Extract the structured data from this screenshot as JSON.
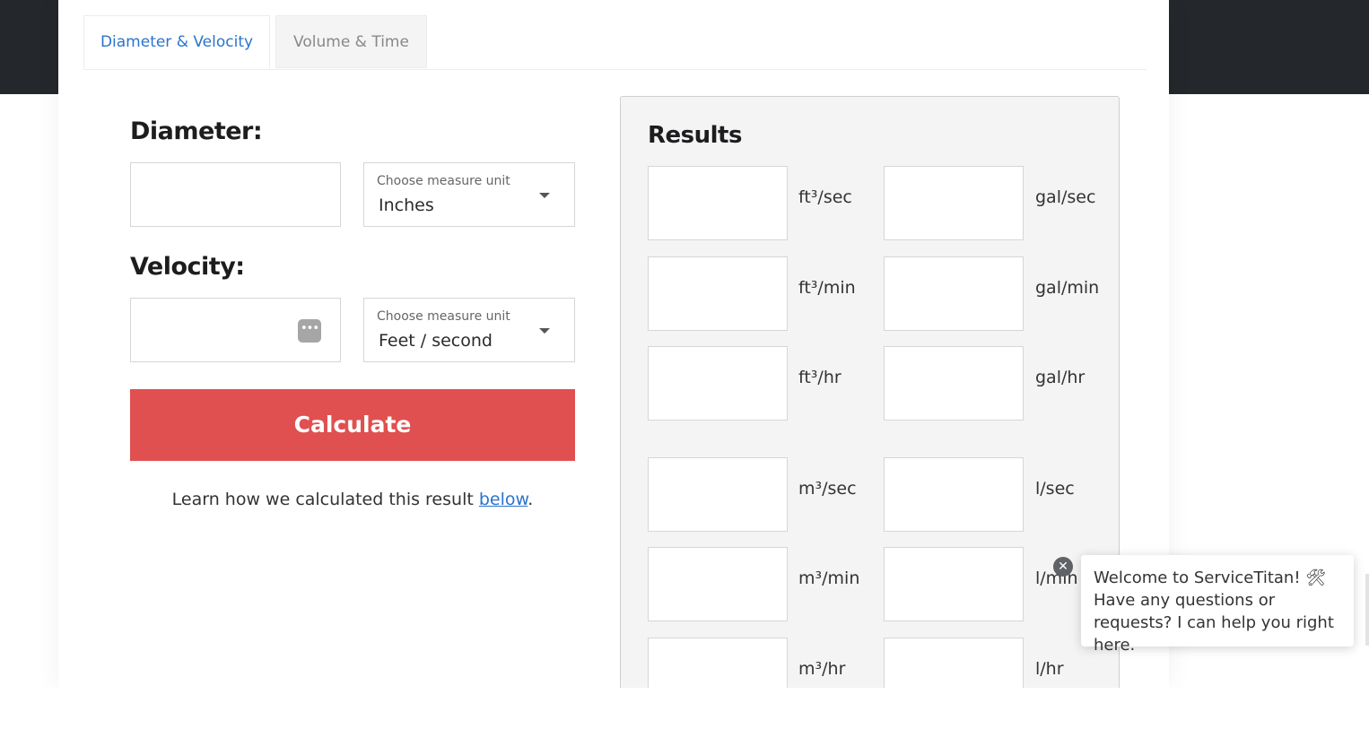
{
  "tabs": {
    "active": "Diameter & Velocity",
    "inactive": "Volume & Time"
  },
  "diameter": {
    "label": "Diameter:",
    "input_value": "",
    "unit_caption": "Choose measure unit",
    "unit_value": "Inches"
  },
  "velocity": {
    "label": "Velocity:",
    "input_value": "",
    "unit_caption": "Choose measure unit",
    "unit_value": "Feet / second"
  },
  "calculate_label": "Calculate",
  "learn": {
    "prefix": "Learn how we calculated this result ",
    "link": "below",
    "suffix": "."
  },
  "results": {
    "title": "Results",
    "units": {
      "ft3_sec": "ft³/sec",
      "gal_sec": "gal/sec",
      "ft3_min": "ft³/min",
      "gal_min": "gal/min",
      "ft3_hr": "ft³/hr",
      "gal_hr": "gal/hr",
      "m3_sec": "m³/sec",
      "l_sec": "l/sec",
      "m3_min": "m³/min",
      "l_min": "l/min",
      "m3_hr": "m³/hr",
      "l_hr": "l/hr"
    }
  },
  "chat": {
    "close": "✕",
    "line1": "Welcome to ServiceTitan! 🛠",
    "line2": "Have any questions or requests? I can help you right here."
  },
  "icons": {
    "password_icon": "password-dots-icon",
    "caret": "chevron-down-icon",
    "close": "close-icon"
  },
  "colors": {
    "accent_blue": "#2a74cc",
    "calculate_red": "#e05050",
    "topbar_dark": "#24272b"
  }
}
